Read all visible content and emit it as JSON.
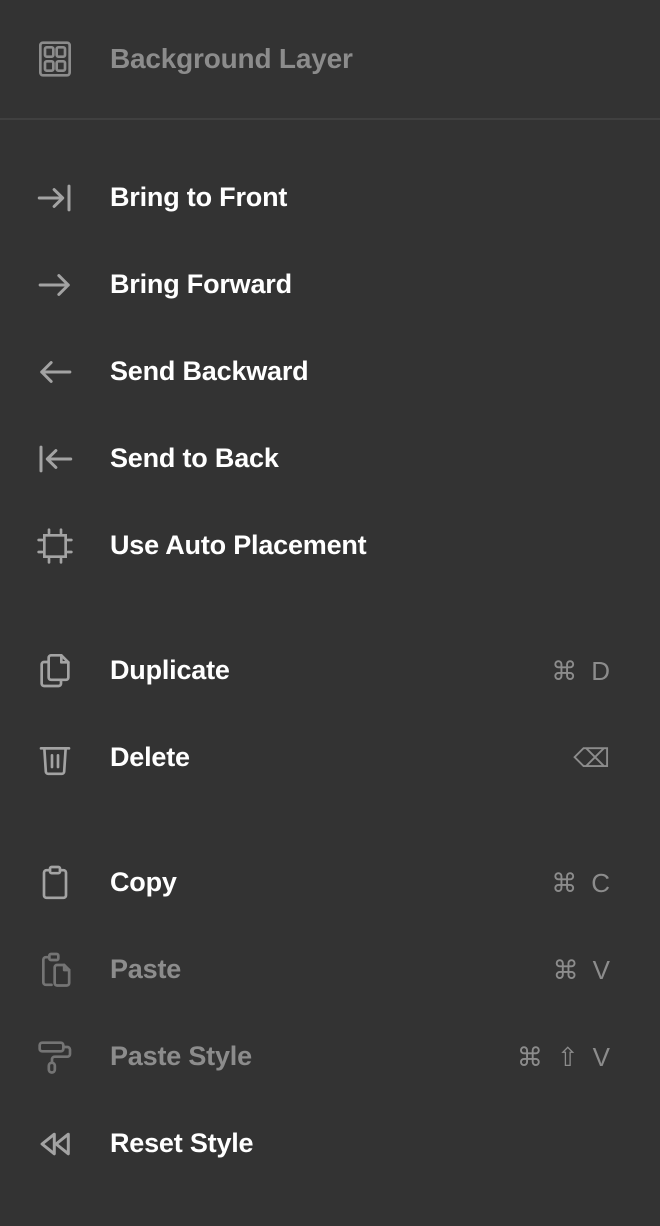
{
  "menu": {
    "background": "#333333",
    "accent_text": "#ffffff",
    "disabled_text": "#8c8c8c",
    "divider_color": "#474747",
    "header": {
      "title": "Background Layer",
      "icon": "layout-grid-icon",
      "enabled": false
    },
    "groups": [
      {
        "items": [
          {
            "label": "Bring to Front",
            "icon": "arrow-right-to-line-icon",
            "shortcut": [],
            "enabled": true
          },
          {
            "label": "Bring Forward",
            "icon": "arrow-right-icon",
            "shortcut": [],
            "enabled": true
          },
          {
            "label": "Send Backward",
            "icon": "arrow-left-icon",
            "shortcut": [],
            "enabled": true
          },
          {
            "label": "Send to Back",
            "icon": "arrow-left-to-line-icon",
            "shortcut": [],
            "enabled": true
          },
          {
            "label": "Use Auto Placement",
            "icon": "auto-placement-icon",
            "shortcut": [],
            "enabled": true
          }
        ]
      },
      {
        "items": [
          {
            "label": "Duplicate",
            "icon": "copy-documents-icon",
            "shortcut": [
              "⌘",
              "D"
            ],
            "enabled": true
          },
          {
            "label": "Delete",
            "icon": "trash-icon",
            "shortcut": [
              "⌫"
            ],
            "enabled": true
          }
        ]
      },
      {
        "items": [
          {
            "label": "Copy",
            "icon": "clipboard-icon",
            "shortcut": [
              "⌘",
              "C"
            ],
            "enabled": true
          },
          {
            "label": "Paste",
            "icon": "clipboard-paste-icon",
            "shortcut": [
              "⌘",
              "V"
            ],
            "enabled": false
          },
          {
            "label": "Paste Style",
            "icon": "paint-roller-icon",
            "shortcut": [
              "⌘",
              "⇧",
              "V"
            ],
            "enabled": false
          },
          {
            "label": "Reset Style",
            "icon": "rewind-icon",
            "shortcut": [],
            "enabled": true
          }
        ]
      }
    ]
  }
}
